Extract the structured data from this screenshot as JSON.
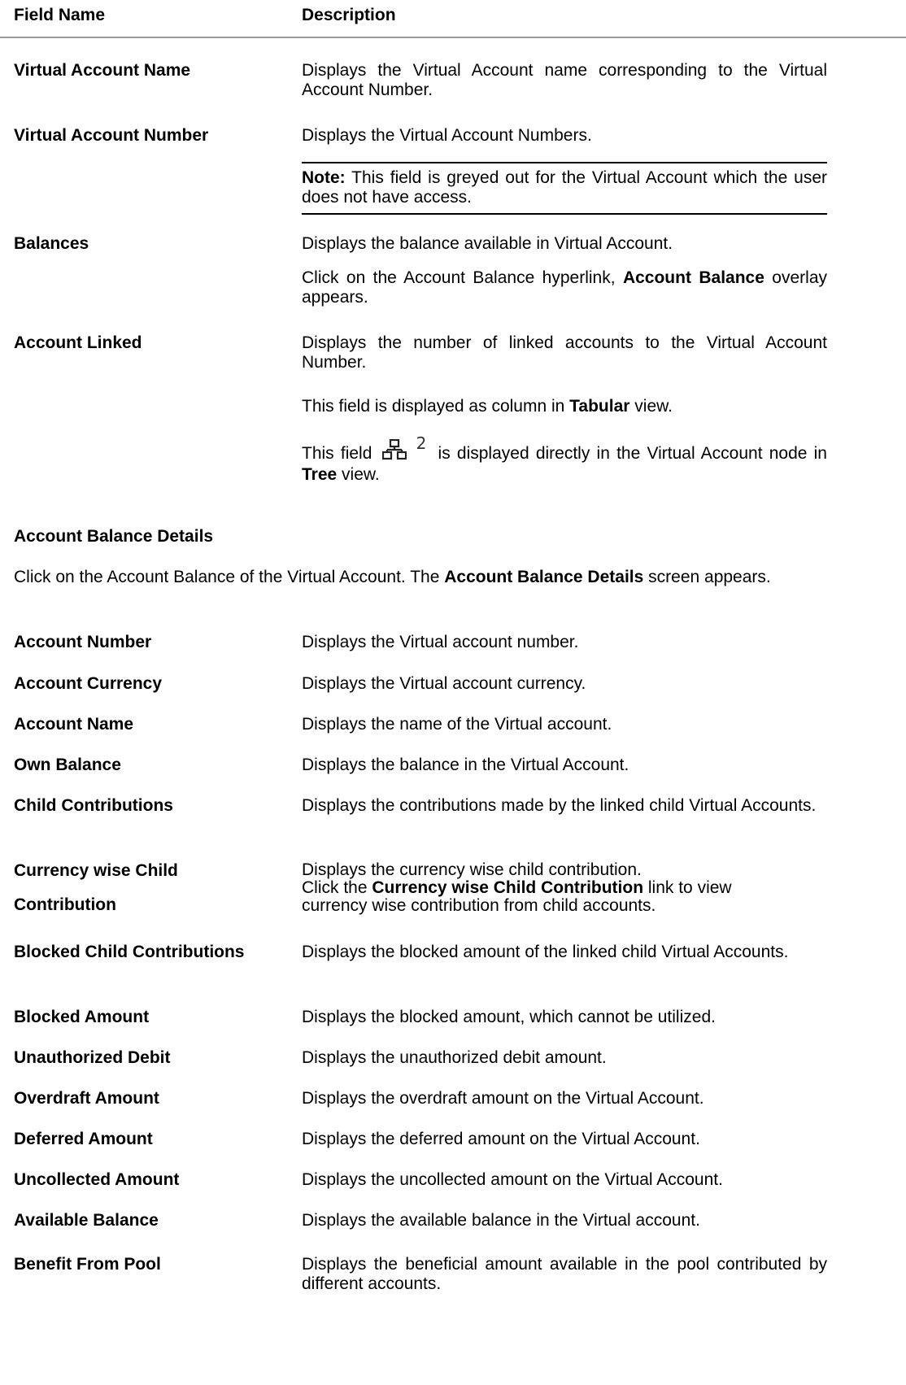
{
  "header": {
    "field_name": "Field Name",
    "description": "Description"
  },
  "rows1": [
    {
      "name": "Virtual Account Name",
      "desc": "Displays the Virtual Account name corresponding to the Virtual Account Number."
    },
    {
      "name": "Virtual Account Number",
      "desc": "Displays the Virtual Account Numbers."
    }
  ],
  "note": {
    "label": "Note:",
    "text": " This field is greyed out for the Virtual Account which the user does not have access."
  },
  "balances": {
    "name": "Balances",
    "desc1": "Displays the balance available in Virtual Account.",
    "desc2_pre": "Click on the Account Balance hyperlink, ",
    "desc2_bold": "Account Balance",
    "desc2_post": " overlay appears."
  },
  "account_linked": {
    "name": "Account Linked",
    "desc1": "Displays the number of linked accounts to the Virtual Account Number.",
    "desc2_pre": "This field is displayed as column in ",
    "desc2_bold": "Tabular",
    "desc2_post": " view.",
    "desc3_pre": "This field ",
    "desc3_count": "2",
    "desc3_mid": " is displayed directly in the Virtual Account node in ",
    "desc3_bold": "Tree",
    "desc3_post": " view.",
    "icon": "hierarchy-icon"
  },
  "section": {
    "title": "Account Balance Details",
    "intro_pre": "Click on the Account Balance of the Virtual Account. The ",
    "intro_bold": "Account Balance Details",
    "intro_post": " screen appears."
  },
  "rows2": [
    {
      "name": "Account Number",
      "desc": "Displays the Virtual account number."
    },
    {
      "name": "Account Currency",
      "desc": "Displays the Virtual account currency."
    },
    {
      "name": "Account Name",
      "desc": "Displays the name of the Virtual account."
    },
    {
      "name": "Own Balance",
      "desc": "Displays the balance in the Virtual Account."
    },
    {
      "name": "Child Contributions",
      "desc": "Displays the contributions made by the linked child Virtual Accounts."
    }
  ],
  "currency_wise": {
    "name_line1": "Currency wise Child",
    "name_line2": "Contribution",
    "desc1": "Displays the currency wise child contribution.",
    "desc2_pre": "Click the ",
    "desc2_bold": "Currency wise Child Contribution",
    "desc2_post": " link to view currency wise contribution from child accounts."
  },
  "rows3": [
    {
      "name": "Blocked Child Contributions",
      "desc": "Displays the blocked amount of the linked child Virtual Accounts."
    },
    {
      "name": "Blocked Amount",
      "desc": "Displays the blocked amount, which cannot be utilized."
    },
    {
      "name": "Unauthorized Debit",
      "desc": "Displays the unauthorized debit amount."
    },
    {
      "name": "Overdraft Amount",
      "desc": "Displays the overdraft amount on the Virtual Account."
    },
    {
      "name": "Deferred Amount",
      "desc": "Displays the deferred amount on the Virtual Account."
    },
    {
      "name": "Uncollected Amount",
      "desc": "Displays the uncollected amount on the Virtual Account."
    },
    {
      "name": "Available Balance",
      "desc": "Displays the available balance in the Virtual account."
    },
    {
      "name": "Benefit From Pool",
      "desc": "Displays the beneficial amount available in the pool contributed by different accounts."
    }
  ]
}
